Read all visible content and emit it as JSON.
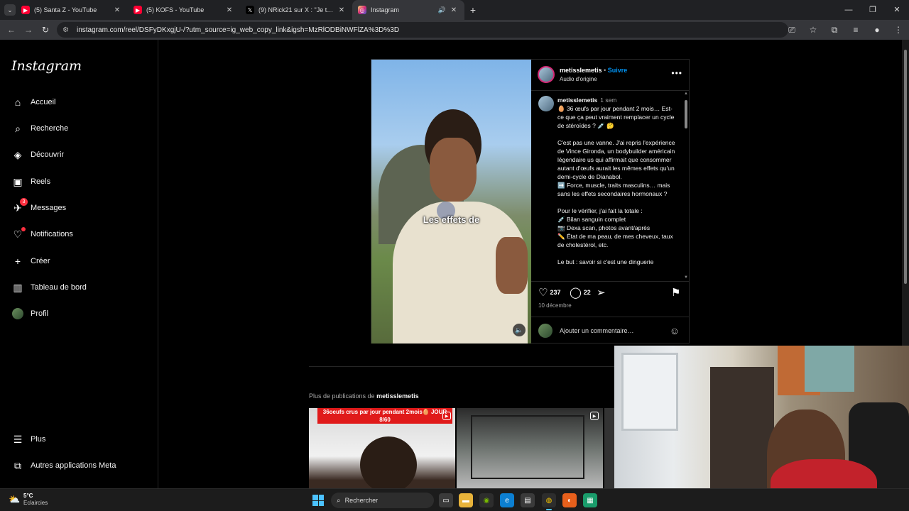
{
  "browser": {
    "tabs": [
      {
        "title": "(5) Santa Z - YouTube",
        "icon": "youtube-icon",
        "color": "#ff0033"
      },
      {
        "title": "(5) KOFS - YouTube",
        "icon": "youtube-icon",
        "color": "#ff0033"
      },
      {
        "title": "(9) NRick21 sur X : \"Je trouve q",
        "icon": "x-icon",
        "color": "#000000"
      },
      {
        "title": "Instagram",
        "icon": "instagram-icon",
        "color": "#d62976",
        "active": true
      }
    ],
    "url": "instagram.com/reel/DSFyDKxgjU-/?utm_source=ig_web_copy_link&igsh=MzRlODBiNWFlZA%3D%3D"
  },
  "sidebar": {
    "logo": "Instagram",
    "items": [
      {
        "label": "Accueil",
        "icon": "home-icon"
      },
      {
        "label": "Recherche",
        "icon": "search-icon"
      },
      {
        "label": "Découvrir",
        "icon": "compass-icon"
      },
      {
        "label": "Reels",
        "icon": "reels-icon"
      },
      {
        "label": "Messages",
        "icon": "messenger-icon",
        "badge": "3"
      },
      {
        "label": "Notifications",
        "icon": "heart-icon"
      },
      {
        "label": "Créer",
        "icon": "plus-icon"
      },
      {
        "label": "Tableau de bord",
        "icon": "dashboard-icon"
      },
      {
        "label": "Profil",
        "icon": "avatar"
      }
    ],
    "bottom": [
      {
        "label": "Plus",
        "icon": "menu-icon"
      },
      {
        "label": "Autres applications Meta",
        "icon": "meta-apps-icon"
      }
    ]
  },
  "post": {
    "overlay_caption": "Les effets de",
    "username": "metisslemetis",
    "separator": "•",
    "follow": "Suivre",
    "audio": "Audio d'origine",
    "caption_time": "1 sem",
    "caption_lines": [
      "🥚 36 œufs par jour pendant 2 mois… Est-ce que ça peut vraiment remplacer un cycle de stéroïdes ? 💉 🤔",
      "",
      "C'est pas une vanne. J'ai repris l'expérience de Vince Gironda, un bodybuilder américain légendaire us qui affirmait que consommer autant d'œufs aurait les mêmes effets qu'un demi-cycle de Dianabol.",
      "➡️ Force, muscle, traits masculins… mais sans les effets secondaires hormonaux ?",
      "",
      "Pour le vérifier, j'ai fait la totale :",
      "💉 Bilan sanguin complet",
      "📷 Dexa scan, photos avant/après",
      "✏️ État de ma peau, de mes cheveux, taux de cholestérol, etc.",
      "",
      "Le but : savoir si c'est une dinguerie"
    ],
    "likes": "237",
    "comments": "22",
    "date": "10 décembre",
    "comment_placeholder": "Ajouter un commentaire…"
  },
  "more": {
    "prefix": "Plus de publications de",
    "username": "metisslemetis",
    "thumb1_banner": "36oeufs crus par jour pendant 2mois🥚 JOUR 8/60"
  },
  "taskbar": {
    "temp": "5°C",
    "weather": "Eclaircies",
    "search": "Rechercher"
  }
}
